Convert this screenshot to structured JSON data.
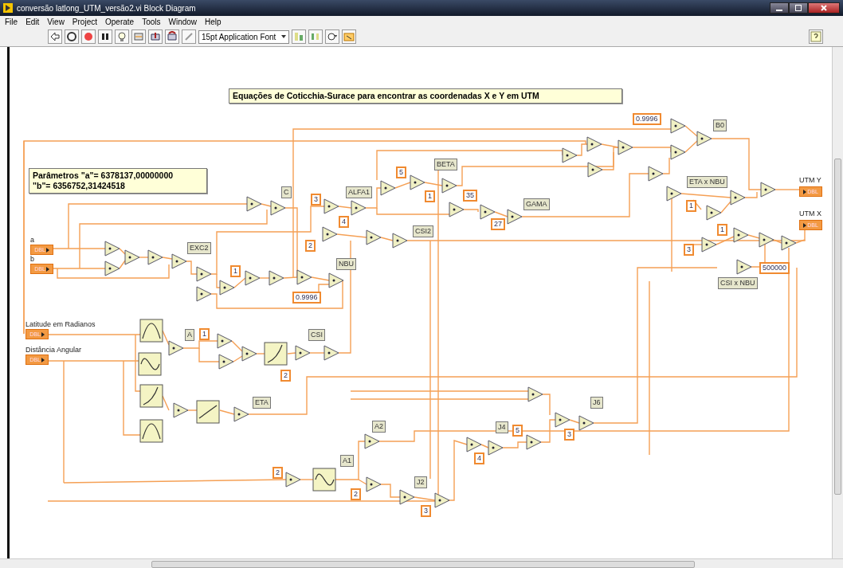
{
  "window": {
    "title": "conversão latlong_UTM_versão2.vi Block Diagram"
  },
  "menu": [
    "File",
    "Edit",
    "View",
    "Project",
    "Operate",
    "Tools",
    "Window",
    "Help"
  ],
  "toolbar": {
    "font": "15pt Application Font"
  },
  "diagram": {
    "comments": [
      {
        "lines": [
          "Equações de Coticchia-Surace para encontrar as coordenadas X e Y em UTM"
        ]
      },
      {
        "lines": [
          "Parâmetros \"a\"= 6378137,00000000",
          "\"b\"= 6356752,31424518"
        ]
      }
    ],
    "controls": [
      {
        "label": "a",
        "type": "DBL"
      },
      {
        "label": "b",
        "type": "DBL"
      },
      {
        "label": "Latitude em Radianos",
        "type": "DBL"
      },
      {
        "label": "Distância Angular",
        "type": "DBL"
      }
    ],
    "indicators": [
      {
        "label": "UTM Y",
        "type": "DBL"
      },
      {
        "label": "UTM X",
        "type": "DBL"
      }
    ],
    "constants": [
      "0.9996",
      "0.9996",
      "3",
      "4",
      "2",
      "5",
      "1",
      "35",
      "27",
      "1",
      "1",
      "1",
      "3",
      "500000",
      "1",
      "2",
      "2",
      "2",
      "3",
      "4",
      "5",
      "3"
    ],
    "wire_labels": [
      "C",
      "ALFA1",
      "BETA",
      "GAMA",
      "EXC2",
      "CSI2",
      "NBU",
      "B0",
      "ETA x NBU",
      "CSI x NBU",
      "A",
      "CSI",
      "ETA",
      "A2",
      "A1",
      "J2",
      "J4",
      "J6"
    ]
  }
}
